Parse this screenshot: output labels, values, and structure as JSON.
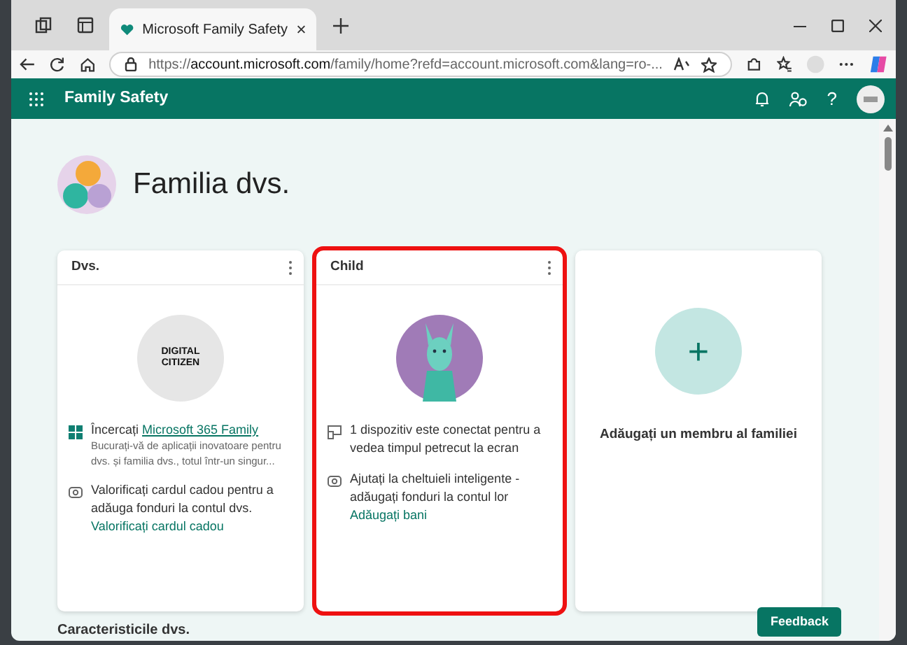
{
  "browser": {
    "tabs": [
      {
        "title": "Microsoft Family Safety",
        "selected": true
      }
    ],
    "url": "https://**account.microsoft.com**/family/home?refd=account.microsoft.com&lang=ro-..."
  },
  "app": {
    "title": "Family Safety",
    "help": "?"
  },
  "page": {
    "heading": "Familia dvs.",
    "members": [
      {
        "kind": "member",
        "name": "Dvs.",
        "logo_lines": [
          "DIGITAL",
          "CITIZEN"
        ],
        "highlighted": false,
        "items": [
          {
            "text": "Încercați ",
            "link": "Microsoft 365 Family",
            "sub": "Bucurați-vă de aplicații inovatoare pentru dvs. și familia dvs., totul într-un singur..."
          },
          {
            "text": "Valorificați cardul cadou pentru a adăuga fonduri la contul dvs.",
            "link": "Valorificați cardul cadou"
          }
        ]
      },
      {
        "kind": "member",
        "name": "Child",
        "highlighted": true,
        "items": [
          {
            "text": "1 dispozitiv este conectat pentru a vedea timpul petrecut la ecran"
          },
          {
            "text": "Ajutați la cheltuieli inteligente - adăugați fonduri la contul lor",
            "link": "Adăugați bani"
          }
        ]
      },
      {
        "kind": "add",
        "label": "Adăugați un membru al familiei",
        "plus": "+"
      }
    ],
    "section": "Caracteristicile dvs.",
    "feedback": "Feedback"
  }
}
